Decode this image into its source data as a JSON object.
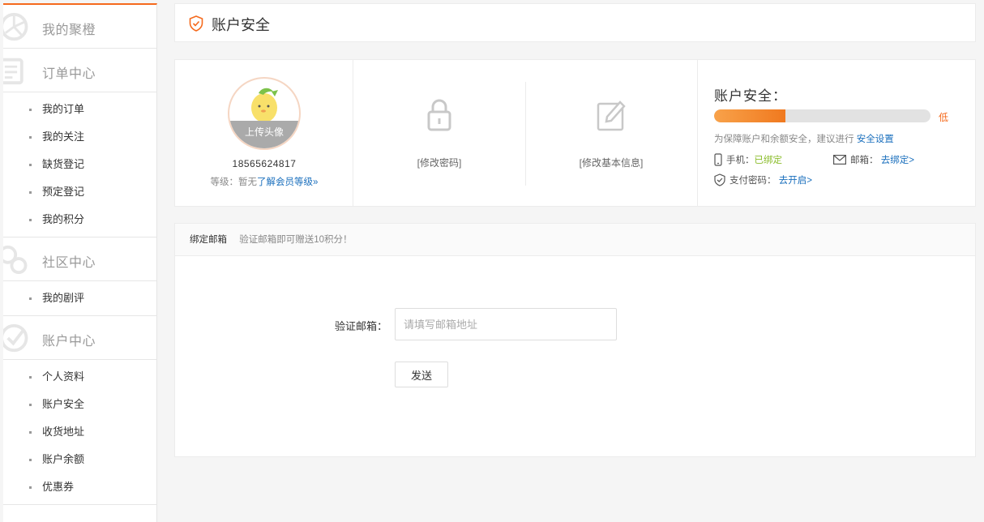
{
  "sidebar": {
    "sections": [
      {
        "title": "我的聚橙",
        "items": []
      },
      {
        "title": "订单中心",
        "items": [
          "我的订单",
          "我的关注",
          "缺货登记",
          "预定登记",
          "我的积分"
        ]
      },
      {
        "title": "社区中心",
        "items": [
          "我的剧评"
        ]
      },
      {
        "title": "账户中心",
        "items": [
          "个人资料",
          "账户安全",
          "收货地址",
          "账户余额",
          "优惠券"
        ]
      }
    ]
  },
  "header": {
    "title": "账户安全"
  },
  "profile": {
    "upload_label": "上传头像",
    "phone": "18565624817",
    "level_prefix": "等级：暂无",
    "level_link": "了解会员等级»"
  },
  "actions": {
    "change_password": "[修改密码]",
    "change_info": "[修改基本信息]"
  },
  "security": {
    "title": "账户安全：",
    "level": "低",
    "level_value": 0.33,
    "tip": "为保障账户和余额安全，建议进行",
    "tip_link": "安全设置",
    "phone_label": "手机：",
    "phone_status": "已绑定",
    "email_label": "邮箱：",
    "email_link": "去绑定>",
    "paypwd_label": "支付密码：",
    "paypwd_link": "去开启>",
    "colors": {
      "accent": "#f56a1d",
      "bound": "#8bbd2c",
      "link": "#1a6fbd"
    }
  },
  "email_bind": {
    "tab": "绑定邮箱",
    "hint": "验证邮箱即可赠送10积分！",
    "field_label": "验证邮箱：",
    "placeholder": "请填写邮箱地址",
    "send_label": "发送"
  }
}
